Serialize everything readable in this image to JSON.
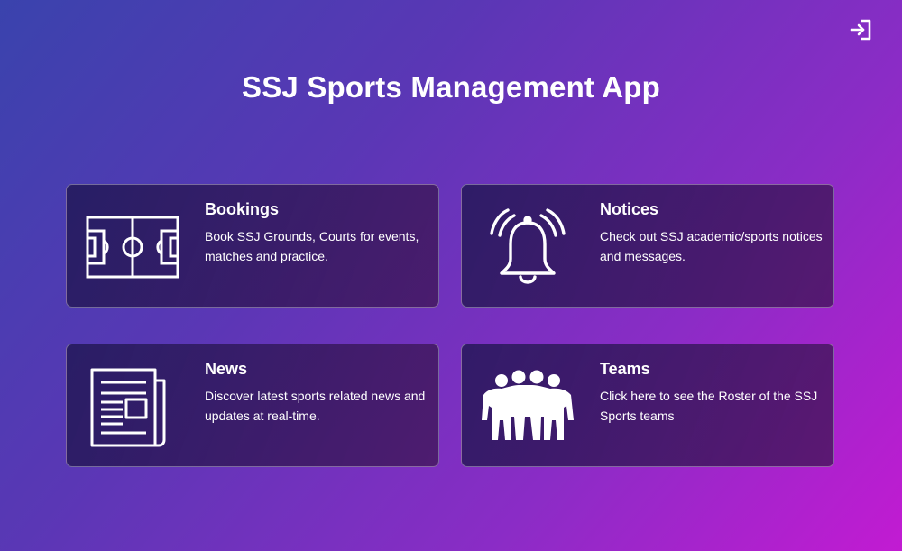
{
  "header": {
    "title": "SSJ Sports Management App",
    "logout_icon": "logout-icon"
  },
  "cards": [
    {
      "title": "Bookings",
      "description": "Book SSJ Grounds, Courts for events, matches and practice.",
      "icon": "football-field-icon"
    },
    {
      "title": "Notices",
      "description": "Check out SSJ academic/sports notices and messages.",
      "icon": "bell-icon"
    },
    {
      "title": "News",
      "description": "Discover latest sports related news and updates at real-time.",
      "icon": "newspaper-icon"
    },
    {
      "title": "Teams",
      "description": "Click here to see the Roster of the SSJ Sports teams",
      "icon": "team-icon"
    }
  ],
  "colors": {
    "gradient_start": "#3a43ad",
    "gradient_end": "#c21bd2",
    "card_bg": "#1e1650",
    "text": "#ffffff"
  }
}
